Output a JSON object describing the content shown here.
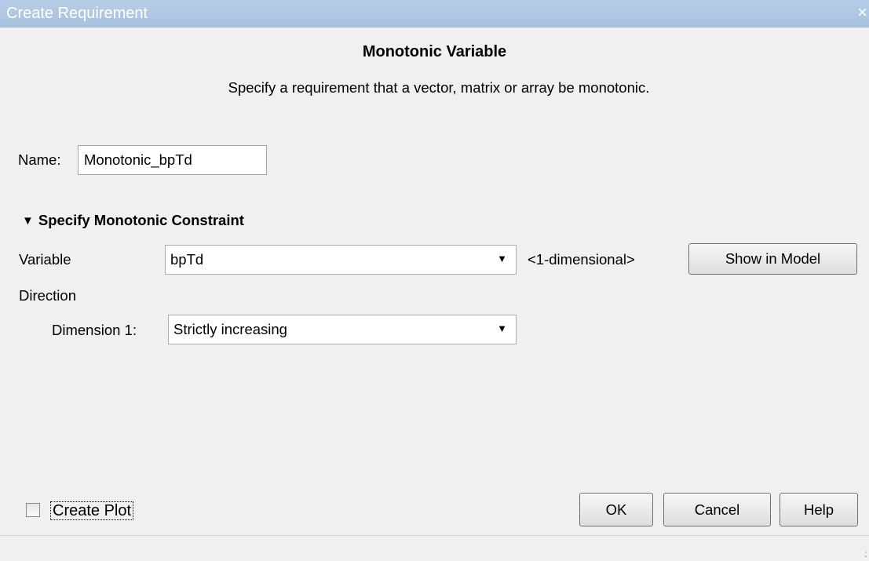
{
  "window": {
    "title": "Create Requirement",
    "close_glyph": "×"
  },
  "heading": "Monotonic Variable",
  "description": "Specify a requirement that a vector, matrix or array be monotonic.",
  "name_field": {
    "label": "Name:",
    "value": "Monotonic_bpTd"
  },
  "section": {
    "title": "Specify Monotonic Constraint",
    "expanded": true,
    "icon": "triangle-down-icon"
  },
  "variable": {
    "label": "Variable",
    "selected": "bpTd",
    "dimension_info": "<1-dimensional>",
    "show_button": "Show in Model"
  },
  "direction": {
    "label": "Direction",
    "dimension_label": "Dimension 1:",
    "selected": "Strictly increasing"
  },
  "footer": {
    "create_plot_label": "Create Plot",
    "create_plot_checked": false,
    "ok": "OK",
    "cancel": "Cancel",
    "help": "Help"
  },
  "colors": {
    "titlebar": "#a8c2e0",
    "background": "#f0f0f0"
  }
}
